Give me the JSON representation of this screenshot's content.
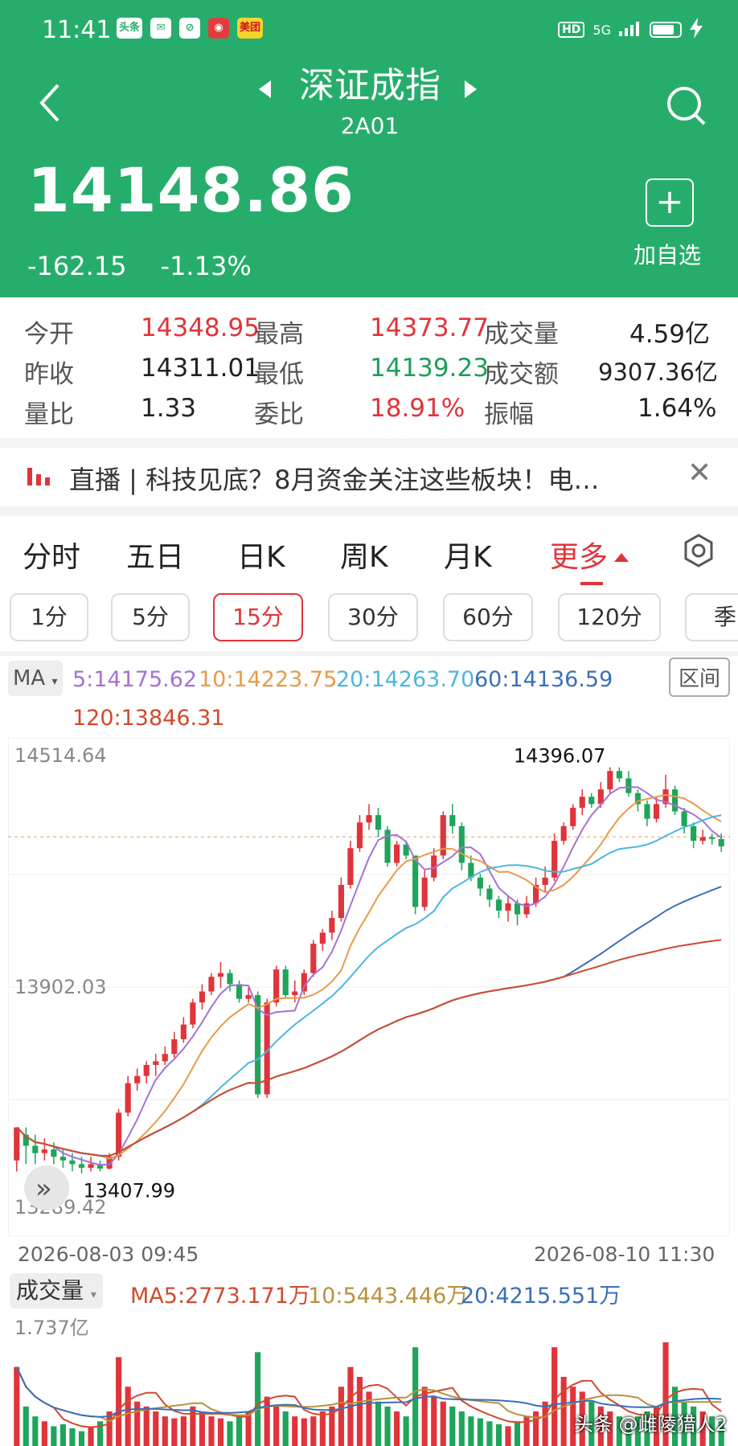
{
  "status": {
    "time": "11:41",
    "app_icons": [
      "头条",
      "✉",
      "⊘",
      "◉",
      "美团"
    ],
    "network": "5G",
    "hd": "HD"
  },
  "nav": {
    "title": "深证成指",
    "subtitle": "2A01"
  },
  "quote": {
    "price": "14148.86",
    "change": "-162.15",
    "change_pct": "-1.13%",
    "add_label": "加自选",
    "add_symbol": "+"
  },
  "stats": {
    "open_label": "今开",
    "open": "14348.95",
    "high_label": "最高",
    "high": "14373.77",
    "volume_label": "成交量",
    "volume": "4.59亿",
    "prev_close_label": "昨收",
    "prev_close": "14311.01",
    "low_label": "最低",
    "low": "14139.23",
    "amount_label": "成交额",
    "amount": "9307.36亿",
    "vol_ratio_label": "量比",
    "vol_ratio": "1.33",
    "order_ratio_label": "委比",
    "order_ratio": "18.91%",
    "amplitude_label": "振幅",
    "amplitude": "1.64%"
  },
  "ticker": {
    "text": "直播 | 科技见底？8月资金关注这些板块！电…",
    "close": "✕"
  },
  "tabs": [
    "分时",
    "五日",
    "日K",
    "周K",
    "月K",
    "更多"
  ],
  "periods": [
    "1分",
    "5分",
    "15分",
    "30分",
    "60分",
    "120分",
    "季"
  ],
  "ma": {
    "badge": "MA",
    "ma5": "5:14175.62",
    "ma10": "10:14223.75",
    "ma20": "20:14263.70",
    "ma60": "60:14136.59",
    "ma120": "120:13846.31",
    "range_button": "区间",
    "colors": {
      "ma5": "#a672d6",
      "ma10": "#e89b4a",
      "ma20": "#4db6e0",
      "ma60": "#3b6fb8",
      "ma120": "#d04a2e"
    }
  },
  "chart_data": {
    "type": "candlestick",
    "y_axis_labels": [
      "14514.64",
      "13902.03",
      "13289.42"
    ],
    "ylim": [
      13289.42,
      14514.64
    ],
    "annotations": {
      "high": "14396.07",
      "low": "13407.99"
    },
    "x_labels": [
      "2026-08-03  09:45",
      "2026-08-10  11:30"
    ],
    "ref_line": 14311.01,
    "candles": [
      [
        13430,
        13520,
        13400,
        13500
      ],
      [
        13500,
        13470,
        13420,
        13520
      ],
      [
        13470,
        13450,
        13420,
        13500
      ],
      [
        13450,
        13460,
        13430,
        13490
      ],
      [
        13460,
        13440,
        13420,
        13480
      ],
      [
        13440,
        13430,
        13410,
        13460
      ],
      [
        13430,
        13420,
        13400,
        13450
      ],
      [
        13420,
        13410,
        13395,
        13440
      ],
      [
        13410,
        13420,
        13400,
        13440
      ],
      [
        13420,
        13408,
        13400,
        13430
      ],
      [
        13408,
        13440,
        13405,
        13450
      ],
      [
        13440,
        13560,
        13430,
        13570
      ],
      [
        13560,
        13640,
        13550,
        13660
      ],
      [
        13640,
        13660,
        13620,
        13680
      ],
      [
        13660,
        13690,
        13640,
        13700
      ],
      [
        13690,
        13700,
        13660,
        13720
      ],
      [
        13700,
        13720,
        13690,
        13740
      ],
      [
        13720,
        13760,
        13710,
        13780
      ],
      [
        13760,
        13800,
        13750,
        13820
      ],
      [
        13800,
        13860,
        13790,
        13870
      ],
      [
        13860,
        13890,
        13840,
        13910
      ],
      [
        13890,
        13930,
        13880,
        13940
      ],
      [
        13930,
        13940,
        13900,
        13970
      ],
      [
        13940,
        13910,
        13890,
        13950
      ],
      [
        13910,
        13870,
        13860,
        13920
      ],
      [
        13870,
        13880,
        13860,
        13900
      ],
      [
        13880,
        13610,
        13600,
        13890
      ],
      [
        13610,
        13860,
        13600,
        13870
      ],
      [
        13860,
        13950,
        13850,
        13960
      ],
      [
        13950,
        13880,
        13870,
        13960
      ],
      [
        13880,
        13890,
        13860,
        13920
      ],
      [
        13890,
        13940,
        13880,
        13950
      ],
      [
        13940,
        14020,
        13930,
        14030
      ],
      [
        14020,
        14050,
        14000,
        14060
      ],
      [
        14050,
        14090,
        14030,
        14110
      ],
      [
        14090,
        14180,
        14080,
        14200
      ],
      [
        14180,
        14280,
        14170,
        14300
      ],
      [
        14280,
        14350,
        14270,
        14370
      ],
      [
        14350,
        14370,
        14330,
        14400
      ],
      [
        14370,
        14330,
        14310,
        14390
      ],
      [
        14330,
        14240,
        14230,
        14340
      ],
      [
        14240,
        14290,
        14230,
        14300
      ],
      [
        14290,
        14260,
        14250,
        14300
      ],
      [
        14260,
        14120,
        14100,
        13980
      ],
      [
        14120,
        14200,
        14110,
        14220
      ],
      [
        14200,
        14260,
        14190,
        14280
      ],
      [
        14260,
        14370,
        14250,
        14380
      ],
      [
        14370,
        14340,
        14320,
        14400
      ],
      [
        14340,
        14240,
        14220,
        14350
      ],
      [
        14240,
        14200,
        14190,
        14260
      ],
      [
        14200,
        14170,
        14150,
        14210
      ],
      [
        14170,
        14140,
        14120,
        14180
      ],
      [
        14140,
        14110,
        14090,
        14150
      ],
      [
        14110,
        14130,
        14080,
        14150
      ],
      [
        14130,
        14100,
        14070,
        14140
      ],
      [
        14100,
        14130,
        14090,
        14150
      ],
      [
        14130,
        14180,
        14120,
        14200
      ],
      [
        14180,
        14200,
        14160,
        14230
      ],
      [
        14200,
        14300,
        14190,
        14320
      ],
      [
        14300,
        14340,
        14290,
        14350
      ],
      [
        14340,
        14390,
        14330,
        14400
      ],
      [
        14390,
        14420,
        14370,
        14440
      ],
      [
        14420,
        14400,
        14390,
        14430
      ],
      [
        14400,
        14440,
        14390,
        14460
      ],
      [
        14440,
        14490,
        14430,
        14500
      ],
      [
        14490,
        14470,
        14460,
        14500
      ],
      [
        14470,
        14430,
        14420,
        14490
      ],
      [
        14430,
        14400,
        14380,
        14440
      ],
      [
        14400,
        14360,
        14340,
        14410
      ],
      [
        14360,
        14400,
        14350,
        14420
      ],
      [
        14400,
        14440,
        14390,
        14480
      ],
      [
        14440,
        14380,
        14370,
        14450
      ],
      [
        14380,
        14340,
        14320,
        14390
      ],
      [
        14340,
        14300,
        14280,
        14350
      ],
      [
        14300,
        14310,
        14290,
        14330
      ],
      [
        14310,
        14305,
        14290,
        14320
      ],
      [
        14305,
        14285,
        14270,
        14320
      ]
    ]
  },
  "volume": {
    "badge": "成交量",
    "ma5": "MA5:2773.171万",
    "ma10": "10:5443.446万",
    "ma20": "20:4215.551万",
    "max_label": "1.737亿",
    "values": [
      80,
      40,
      30,
      25,
      20,
      22,
      18,
      15,
      20,
      25,
      35,
      90,
      60,
      45,
      40,
      35,
      30,
      28,
      30,
      40,
      35,
      30,
      28,
      25,
      30,
      35,
      95,
      50,
      40,
      35,
      30,
      28,
      30,
      35,
      40,
      60,
      80,
      70,
      55,
      45,
      40,
      35,
      30,
      100,
      60,
      50,
      45,
      40,
      35,
      30,
      28,
      25,
      22,
      20,
      25,
      30,
      35,
      45,
      100,
      70,
      60,
      55,
      45,
      40,
      35,
      30,
      25,
      30,
      35,
      40,
      105,
      60,
      45,
      40,
      35,
      30,
      25
    ]
  },
  "watermark": "头条 @雌陵猎人2"
}
